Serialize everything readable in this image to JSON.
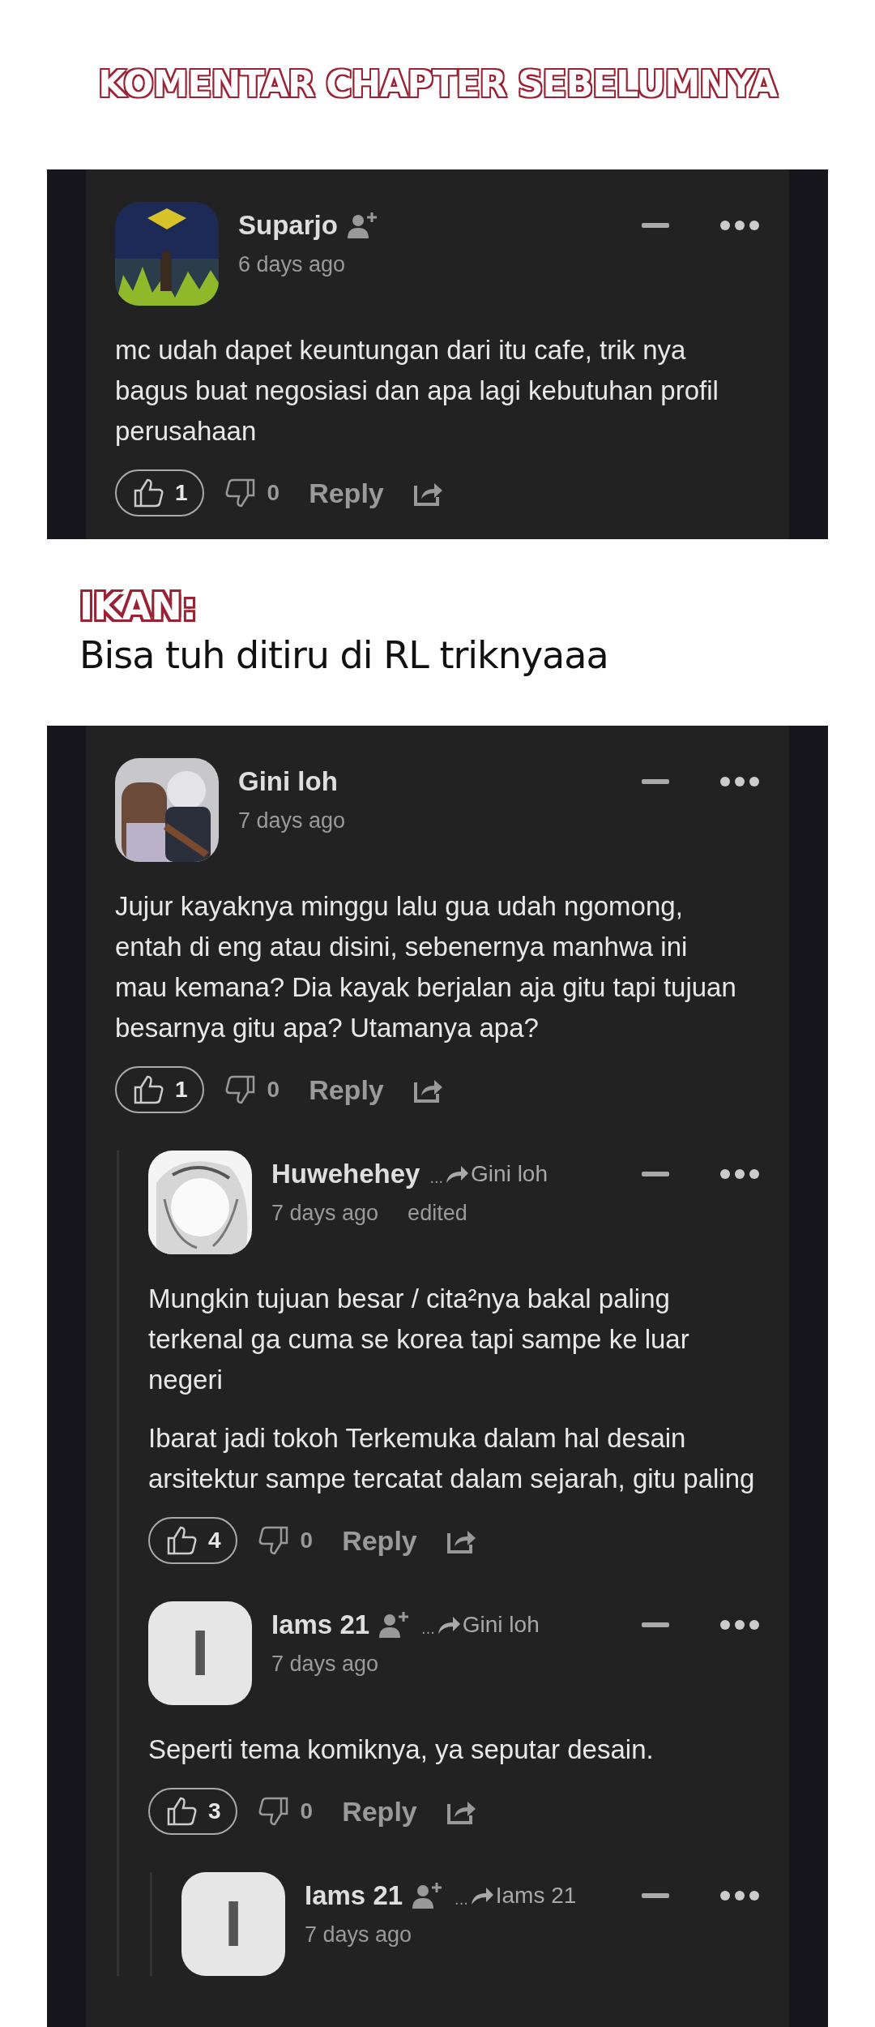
{
  "title": "KOMENTAR CHAPTER SEBELUMNYA",
  "panels": [
    {
      "comments": [
        {
          "avatar": {
            "kind": "picture"
          },
          "name": "Suparjo",
          "follow": true,
          "time": "6 days ago",
          "body": [
            "mc udah dapet keuntungan dari itu cafe, trik nya bagus buat negosiasi dan apa lagi kebutuhan profil perusahaan"
          ],
          "likes": "1",
          "dislikes": "0",
          "reply": "Reply"
        }
      ]
    },
    {
      "note": {
        "label": "IKAN:",
        "text": "Bisa tuh ditiru di RL triknyaaa"
      },
      "comments": [
        {
          "avatar": {
            "kind": "picture"
          },
          "name": "Gini loh",
          "follow": false,
          "time": "7 days ago",
          "body": [
            "Jujur kayaknya minggu lalu gua udah ngomong, entah di eng atau disini, sebenernya manhwa ini mau kemana? Dia kayak berjalan aja gitu tapi tujuan besarnya gitu apa? Utamanya apa?"
          ],
          "likes": "1",
          "dislikes": "0",
          "reply": "Reply",
          "children": [
            {
              "avatar": {
                "kind": "picture"
              },
              "name": "Huwehehey",
              "follow": false,
              "reply_to": {
                "dots": "...",
                "name": "Gini loh"
              },
              "time": "7 days ago",
              "edited": "edited",
              "body": [
                "Mungkin tujuan besar / cita²nya bakal paling terkenal ga cuma se korea tapi sampe ke luar negeri",
                "Ibarat jadi tokoh Terkemuka dalam hal desain arsitektur sampe tercatat dalam sejarah, gitu paling"
              ],
              "likes": "4",
              "dislikes": "0",
              "reply": "Reply"
            },
            {
              "avatar": {
                "kind": "letter",
                "letter": "I"
              },
              "name": "Iams 21",
              "follow": true,
              "reply_to": {
                "dots": "...",
                "name": "Gini loh"
              },
              "time": "7 days ago",
              "body": [
                "Seperti tema komiknya, ya seputar desain."
              ],
              "likes": "3",
              "dislikes": "0",
              "reply": "Reply",
              "children": [
                {
                  "avatar": {
                    "kind": "letter",
                    "letter": "I"
                  },
                  "name": "Iams 21",
                  "follow": true,
                  "reply_to": {
                    "dots": "...",
                    "name": "Iams 21"
                  },
                  "time": "7 days ago"
                }
              ]
            }
          ]
        }
      ]
    }
  ]
}
